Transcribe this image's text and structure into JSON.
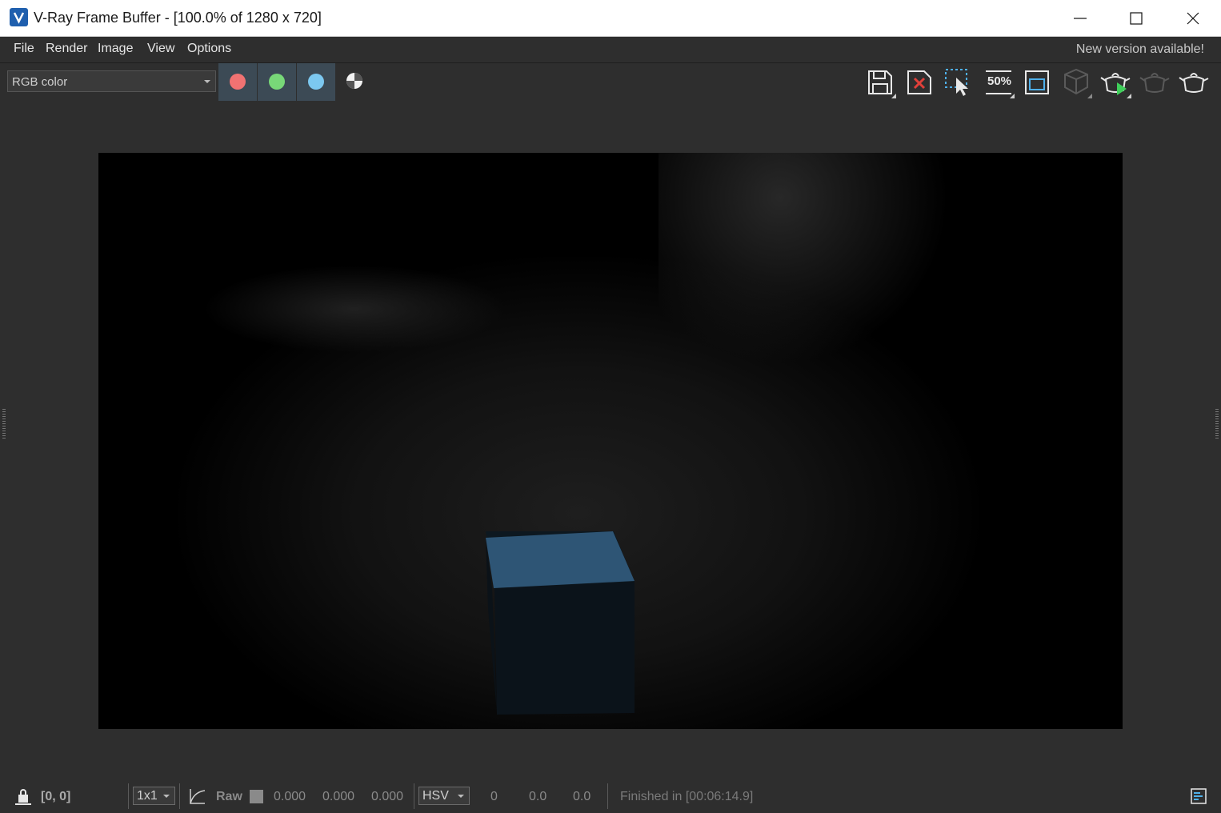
{
  "window": {
    "title": "V-Ray Frame Buffer - [100.0% of 1280 x 720]",
    "controls": [
      "minimize",
      "maximize",
      "close"
    ]
  },
  "menu": {
    "items": [
      "File",
      "Render",
      "Image",
      "View",
      "Options"
    ],
    "notice": "New version available!"
  },
  "toolbar": {
    "channel": "RGB color",
    "channel_buttons": [
      {
        "name": "red-channel",
        "color": "#f07272"
      },
      {
        "name": "green-channel",
        "color": "#78d878"
      },
      {
        "name": "blue-channel",
        "color": "#7cc8f0"
      }
    ],
    "icons": [
      "save-icon",
      "clear-image-icon",
      "track-mouse-icon",
      "zoom-50-icon",
      "region-render-icon",
      "stop-render-icon",
      "render-interactive-icon",
      "render-last-icon",
      "render-icon"
    ],
    "zoom_label": "50%"
  },
  "status": {
    "coords": "[0, 0]",
    "sample_size": "1x1",
    "mode": "Raw",
    "r": "0.000",
    "g": "0.000",
    "b": "0.000",
    "color_space": "HSV",
    "h": "0",
    "s": "0.0",
    "v": "0.0",
    "message": "Finished in [00:06:14.9]"
  },
  "colors": {
    "background": "#2e2e2e",
    "accent_blue": "#4fb0ea",
    "clear_red": "#e0403a"
  }
}
